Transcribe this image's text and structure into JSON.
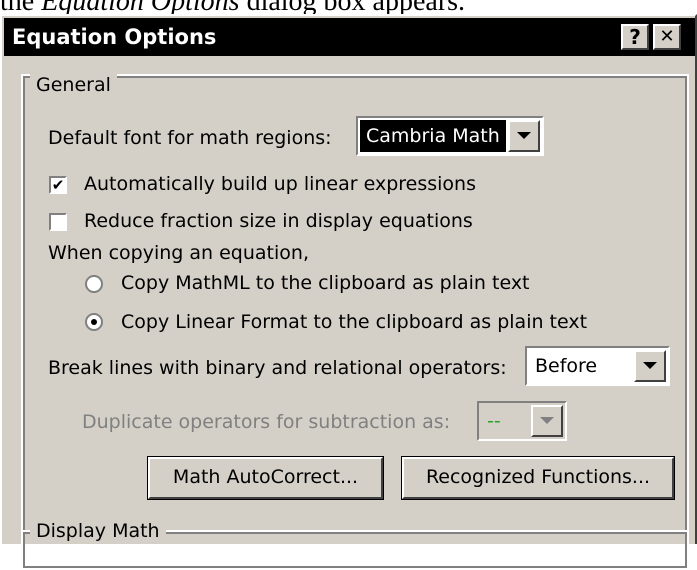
{
  "caption": {
    "prefix": "the ",
    "italic": "Equation Options",
    "suffix": " dialog box appears."
  },
  "dialog": {
    "title": "Equation Options",
    "help_label": "?",
    "close_label": "✕"
  },
  "general": {
    "legend": "General",
    "default_font_label": "Default font for math regions:",
    "default_font_value": "Cambria Math",
    "auto_build_label": "Automatically build up linear expressions",
    "auto_build_checked": true,
    "reduce_fraction_label": "Reduce fraction size in display equations",
    "reduce_fraction_checked": false,
    "copying_label": "When copying an equation,",
    "copy_mathml_label": "Copy MathML to the clipboard as plain text",
    "copy_linear_label": "Copy Linear Format to the clipboard as plain text",
    "selected_copy_option": "linear",
    "break_lines_label": "Break lines with binary and relational operators:",
    "break_lines_value": "Before",
    "duplicate_label": "Duplicate operators for subtraction as:",
    "duplicate_value": "--",
    "math_autocorrect_button": "Math AutoCorrect...",
    "recognized_functions_button": "Recognized Functions..."
  },
  "display_math": {
    "legend": "Display Math"
  },
  "colors": {
    "dialog_bg": "#d4d0c8",
    "titlebar_bg": "#000000",
    "disabled_text": "#808080",
    "duplicate_value_color": "#2aa02a"
  }
}
